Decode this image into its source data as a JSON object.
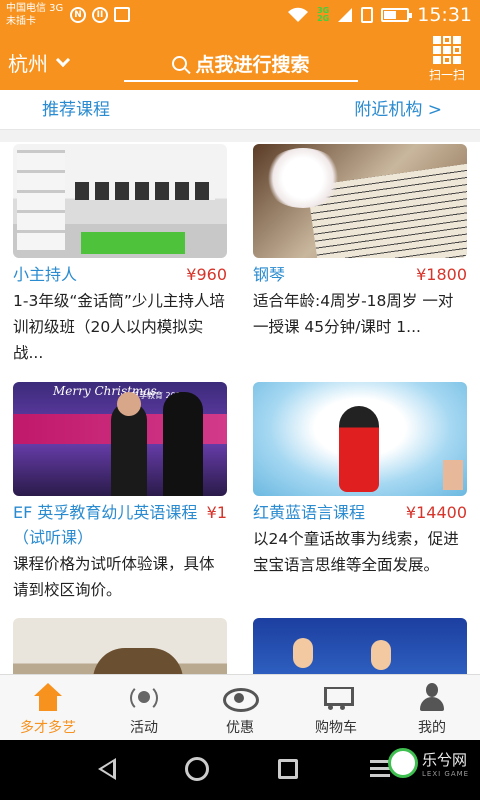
{
  "status_bar": {
    "carrier_line1": "中国电信 3G",
    "carrier_line2": "未插卡",
    "network_badge_top": "3G",
    "network_badge_bottom": "2G",
    "time": "15:31",
    "battery_level": 0.5
  },
  "header": {
    "city": "杭州",
    "search_text": "点我进行搜索",
    "scan_label": "扫一扫"
  },
  "subheader": {
    "left": "推荐课程",
    "right": "附近机构 >"
  },
  "courses": [
    {
      "title": "小主持人",
      "price": "¥960",
      "desc": "1-3年级“金话筒”少儿主持人培训初级班（20人以内模拟实战...",
      "image": "classroom-photo"
    },
    {
      "title": "钢琴",
      "price": "¥1800",
      "desc": "适合年龄:4周岁-18周岁 一对一授课 45分钟/课时 1...",
      "image": "piano-sheet-music-photo"
    },
    {
      "title": "EF 英孚教育幼儿英语课程（试听课）",
      "price": "¥1",
      "desc": "课程价格为试听体验课，具体请到校区询价。",
      "image": "christmas-stage-photo"
    },
    {
      "title": "红黄蓝语言课程",
      "price": "¥14400",
      "desc": "以24个童话故事为线索，促进宝宝语言思维等全面发展。",
      "image": "girl-singing-photo"
    },
    {
      "title": "",
      "price": "",
      "desc": "",
      "image": "teapot-photo"
    },
    {
      "title": "",
      "price": "",
      "desc": "",
      "image": "kids-tv-stage-photo"
    }
  ],
  "image_text": {
    "christmas_heading": "Merry Christmas",
    "banner": "英孚教育 2011"
  },
  "tabs": [
    {
      "label": "多才多艺",
      "icon": "house-icon",
      "active": true
    },
    {
      "label": "活动",
      "icon": "broadcast-icon",
      "active": false
    },
    {
      "label": "优惠",
      "icon": "eye-icon",
      "active": false
    },
    {
      "label": "购物车",
      "icon": "cart-icon",
      "active": false
    },
    {
      "label": "我的",
      "icon": "user-icon",
      "active": false
    }
  ],
  "watermark": {
    "text": "乐兮网",
    "sub": "LEXI GAME"
  },
  "colors": {
    "brand_orange": "#f7921e",
    "link_blue": "#2a8bd0",
    "price_red": "#d6352b"
  }
}
